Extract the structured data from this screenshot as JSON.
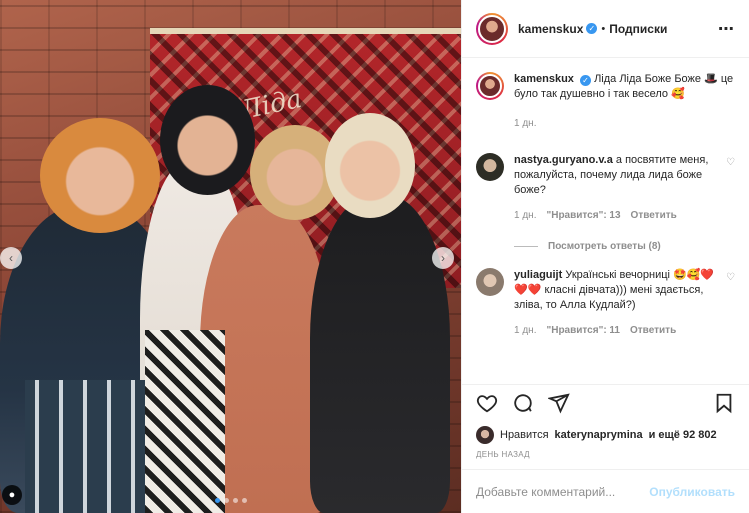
{
  "post": {
    "author": "kamenskux",
    "follow_label": "Подписки",
    "separator": "•",
    "caption_author": "kamenskux",
    "caption_text": "Ліда Ліда Боже Боже 🎩 це було так душевно і так весело 🥰",
    "caption_time": "1 дн.",
    "photo_text": "Ліда"
  },
  "comments": [
    {
      "user": "nastya.guryano.v.a",
      "text": "а посвятите меня, пожалуйста, почему лида лида боже боже?",
      "time": "1 дн.",
      "likes": "\"Нравится\": 13",
      "reply": "Ответить"
    },
    {
      "user": "yuliaguijt",
      "text": "Українські вечорниці 🤩🥰❤️❤️❤️ класні дівчата))) мені здається, зліва, то Алла Кудлай?)",
      "time": "1 дн.",
      "likes": "\"Нравится\": 11",
      "reply": "Ответить"
    }
  ],
  "view_replies": "Посмотреть ответы (8)",
  "likes_bar": {
    "prefix": "Нравится",
    "liker": "katerynaprymina",
    "suffix": "и ещё 92 802"
  },
  "date": "ДЕНЬ НАЗАД",
  "comment_input": {
    "placeholder": "Добавьте комментарий...",
    "value": ""
  },
  "publish_label": "Опубликовать",
  "icons": {
    "more": "⋯",
    "heart": "heart-icon",
    "comment": "comment-icon",
    "share": "share-icon",
    "bookmark": "bookmark-icon"
  },
  "colors": {
    "link": "#3897f0",
    "publish_disabled": "#b2dffc",
    "muted": "#8e8e8e"
  }
}
